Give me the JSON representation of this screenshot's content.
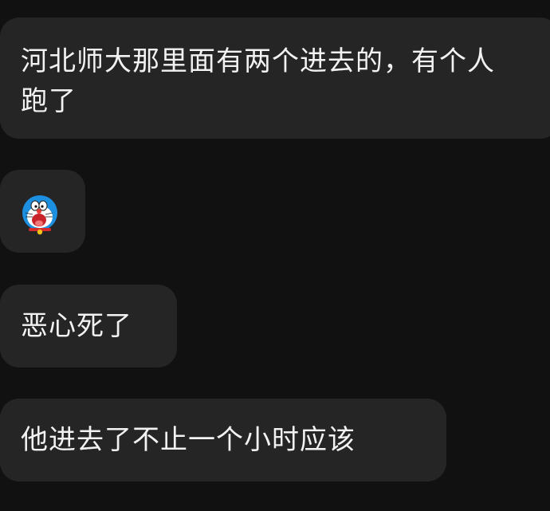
{
  "messages": [
    {
      "text": "河北师大那里面有两个进去的，有个人跑了"
    },
    {
      "sticker": "doraemon-sticker-icon"
    },
    {
      "text": "恶心死了"
    },
    {
      "text": "他进去了不止一个小时应该"
    }
  ],
  "colors": {
    "background": "#111111",
    "bubble": "#252526",
    "text": "#f2f2f2"
  }
}
